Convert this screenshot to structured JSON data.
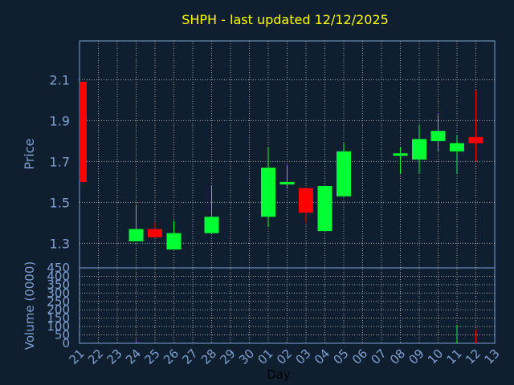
{
  "chart_data": {
    "type": "candlestick",
    "title": "SHPH - last updated 12/12/2025",
    "xlabel": "Day",
    "ylabel": "Price",
    "volume_label": "Volume (0000)",
    "x_ticks": [
      "21",
      "22",
      "23",
      "24",
      "25",
      "26",
      "27",
      "28",
      "29",
      "30",
      "01",
      "02",
      "03",
      "04",
      "05",
      "06",
      "07",
      "08",
      "09",
      "10",
      "11",
      "12",
      "13"
    ],
    "price_ylim": [
      1.18,
      2.29
    ],
    "price_ticks": [
      "2.1",
      "1.9",
      "1.7",
      "1.5",
      "1.3"
    ],
    "volume_ylim": [
      0,
      450
    ],
    "volume_ticks": [
      "450",
      "400",
      "350",
      "300",
      "250",
      "200",
      "150",
      "100",
      "50",
      "0"
    ],
    "grid": true,
    "colors": {
      "up": "#00ff33",
      "down": "#ff0000",
      "background": "#0f1f30",
      "title": "#ffff00",
      "axis_text": "#7f9fcf"
    },
    "candles": [
      {
        "day": "21",
        "open": 2.09,
        "close": 1.6,
        "high": 2.09,
        "low": 1.6
      },
      {
        "day": "24",
        "open": 1.31,
        "close": 1.37,
        "high": 1.49,
        "low": 1.31
      },
      {
        "day": "25",
        "open": 1.37,
        "close": 1.33,
        "high": 1.4,
        "low": 1.33
      },
      {
        "day": "26",
        "open": 1.27,
        "close": 1.35,
        "high": 1.41,
        "low": 1.27
      },
      {
        "day": "28",
        "open": 1.35,
        "close": 1.43,
        "high": 1.58,
        "low": 1.35
      },
      {
        "day": "01",
        "open": 1.43,
        "close": 1.67,
        "high": 1.77,
        "low": 1.38
      },
      {
        "day": "02",
        "open": 1.59,
        "close": 1.6,
        "high": 1.68,
        "low": 1.57
      },
      {
        "day": "03",
        "open": 1.57,
        "close": 1.45,
        "high": 1.57,
        "low": 1.4
      },
      {
        "day": "04",
        "open": 1.36,
        "close": 1.58,
        "high": 1.58,
        "low": 1.36
      },
      {
        "day": "05",
        "open": 1.53,
        "close": 1.75,
        "high": 1.79,
        "low": 1.53
      },
      {
        "day": "08",
        "open": 1.73,
        "close": 1.74,
        "high": 1.77,
        "low": 1.64
      },
      {
        "day": "09",
        "open": 1.71,
        "close": 1.81,
        "high": 1.88,
        "low": 1.64
      },
      {
        "day": "10",
        "open": 1.8,
        "close": 1.85,
        "high": 1.93,
        "low": 1.75
      },
      {
        "day": "11",
        "open": 1.75,
        "close": 1.79,
        "high": 1.83,
        "low": 1.64
      },
      {
        "day": "12",
        "open": 1.82,
        "close": 1.79,
        "high": 2.05,
        "low": 1.7
      }
    ],
    "volume": [
      {
        "day": "24",
        "value": 15
      },
      {
        "day": "11",
        "value": 110
      },
      {
        "day": "12",
        "value": 80
      }
    ]
  }
}
